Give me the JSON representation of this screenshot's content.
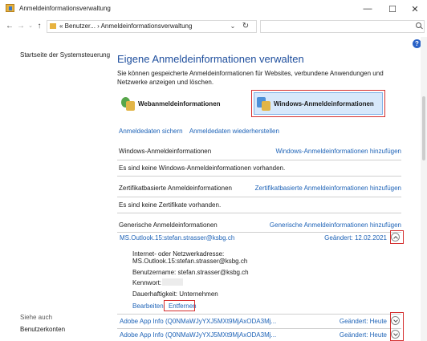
{
  "window": {
    "title": "Anmeldeinformationsverwaltung",
    "minimize": "—",
    "maximize": "☐",
    "close": "✕"
  },
  "addressbar": {
    "back": "←",
    "forward": "→",
    "recent": "⌄",
    "up": "↑",
    "path": "« Benutzer... › Anmeldeinformationsverwaltung",
    "dropdown": "⌄",
    "refresh": "↻"
  },
  "sidebar": {
    "home_link": "Startseite der Systemsteuerung",
    "see_also": "Siehe auch",
    "user_accounts": "Benutzerkonten"
  },
  "main": {
    "title": "Eigene Anmeldeinformationen verwalten",
    "description": "Sie können gespeicherte Anmeldeinformationen für Websites, verbundene Anwendungen und Netzwerke anzeigen und löschen.",
    "web_credentials": "Webanmeldeinformationen",
    "windows_credentials": "Windows-Anmeldeinformationen",
    "backup": "Anmeldedaten sichern",
    "restore": "Anmeldedaten wiederherstellen"
  },
  "sections": {
    "windows": {
      "label": "Windows-Anmeldeinformationen",
      "add": "Windows-Anmeldeinformationen hinzufügen",
      "empty": "Es sind keine Windows-Anmeldeinformationen vorhanden."
    },
    "cert": {
      "label": "Zertifikatbasierte Anmeldeinformationen",
      "add": "Zertifikatbasierte Anmeldeinformationen hinzufügen",
      "empty": "Es sind keine Zertifikate vorhanden."
    },
    "generic": {
      "label": "Generische Anmeldeinformationen",
      "add": "Generische Anmeldeinformationen hinzufügen"
    }
  },
  "entries": [
    {
      "name": "MS.Outlook.15:stefan.strasser@ksbg.ch",
      "changed": "Geändert: 12.02.2021",
      "expanded": true
    },
    {
      "name": "Adobe App Info (Q0NMaWJyYXJ5MXt9MjAxODA3Mj...",
      "changed": "Geändert: Heute",
      "expanded": false
    },
    {
      "name": "Adobe App Info (Q0NMaWJyYXJ5MXt9MjAxODA3Mj...",
      "changed": "Geändert: Heute",
      "expanded": false
    }
  ],
  "details": {
    "address_label": "Internet- oder Netzwerkadresse:",
    "address_value": "MS.Outlook.15:stefan.strasser@ksbg.ch",
    "user": "Benutzername:  stefan.strasser@ksbg.ch",
    "password": "Kennwort:",
    "persistence": "Dauerhaftigkeit:  Unternehmen",
    "edit": "Bearbeiten",
    "remove": "Entfernen"
  },
  "help": "?",
  "colors": {
    "link": "#1e63b7",
    "title": "#1e4e9d",
    "highlight_box": "#d42f2f",
    "selected_tab": "#d7e8fb"
  }
}
